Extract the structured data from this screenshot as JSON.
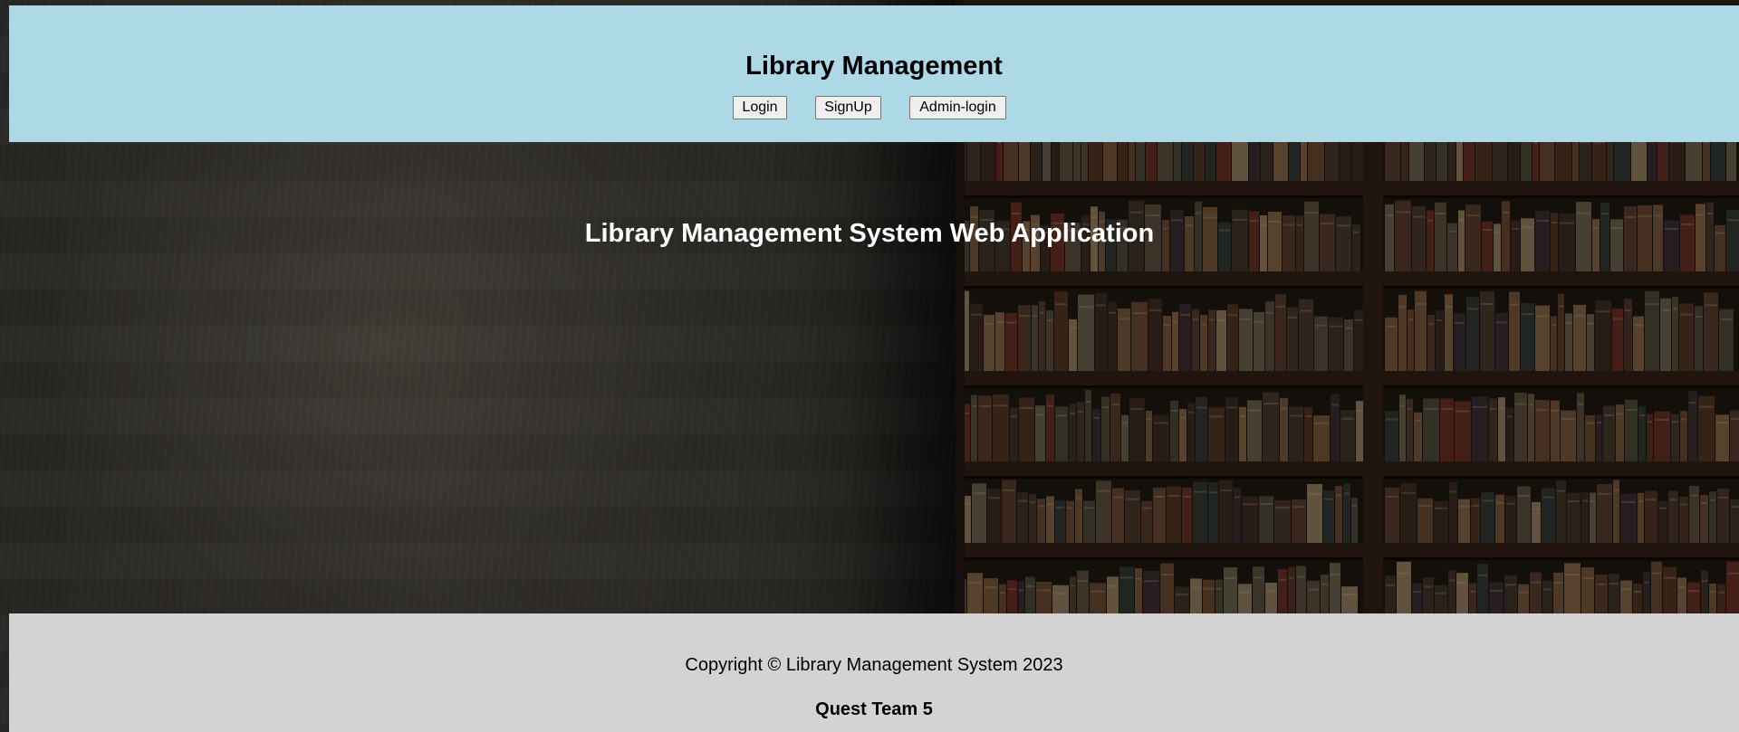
{
  "header": {
    "title": "Library Management",
    "nav": {
      "login_label": "Login",
      "signup_label": "SignUp",
      "admin_login_label": "Admin-login"
    }
  },
  "hero": {
    "title": "Library Management System Web Application",
    "background": "library-bookshelf-image"
  },
  "footer": {
    "copyright": "Copyright © Library Management System 2023",
    "team": "Quest Team 5"
  },
  "colors": {
    "header_bg": "#add8e6",
    "footer_bg": "#d3d3d3",
    "hero_text": "#ffffff"
  }
}
